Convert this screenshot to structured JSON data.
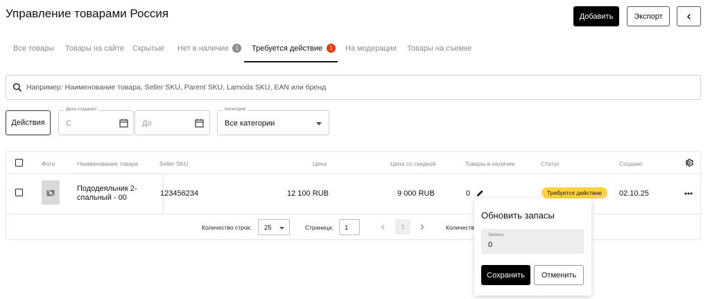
{
  "header": {
    "title": "Управление товарами Россия",
    "add_label": "Добавить",
    "export_label": "Экспорт"
  },
  "tabs": [
    {
      "label": "Все товары"
    },
    {
      "label": "Товары на сайте"
    },
    {
      "label": "Скрытые"
    },
    {
      "label": "Нет в наличии",
      "badge": "1"
    },
    {
      "label": "Требуется действие",
      "badge": "1",
      "active": true
    },
    {
      "label": "На модерации"
    },
    {
      "label": "Товары на съемке"
    }
  ],
  "search": {
    "placeholder": "Например: Наименование товара, Seller SKU, Parent SKU, Lamoda SKU, EAN или бренд"
  },
  "filters": {
    "actions_label": "Действия",
    "date_legend": "Дата создания",
    "from_placeholder": "С",
    "to_placeholder": "До",
    "category_legend": "Категории",
    "category_value": "Все категории"
  },
  "table": {
    "columns": {
      "photo": "Фото",
      "name": "Наименование товара",
      "seller_sku": "Seller SKU",
      "price": "Цена",
      "discount_price": "Цена со скидкой",
      "stock": "Товары в наличии",
      "status": "Статус",
      "created": "Создано"
    },
    "rows": [
      {
        "name_line1": "Пододеяльник 2-",
        "name_line2": "спальный - 00",
        "seller_sku": "123456234",
        "price": "12 100 RUB",
        "discount_price": "9 000 RUB",
        "stock": "0",
        "status": "Требуется действие",
        "created": "02.10.25"
      }
    ],
    "footer": {
      "rows_label": "Количество строк:",
      "rows_value": "25",
      "page_label": "Страница:",
      "page_value": "1",
      "current_page": "1",
      "count_label": "Количеств"
    }
  },
  "popover": {
    "title": "Обновить запасы",
    "field_label": "Запасы",
    "field_value": "0",
    "save_label": "Сохранить",
    "cancel_label": "Отменить"
  },
  "colors": {
    "primary": "#000000",
    "badge_alert": "#e8380d",
    "badge_muted": "#8d8d8d",
    "status_warning": "#ffd43b"
  }
}
